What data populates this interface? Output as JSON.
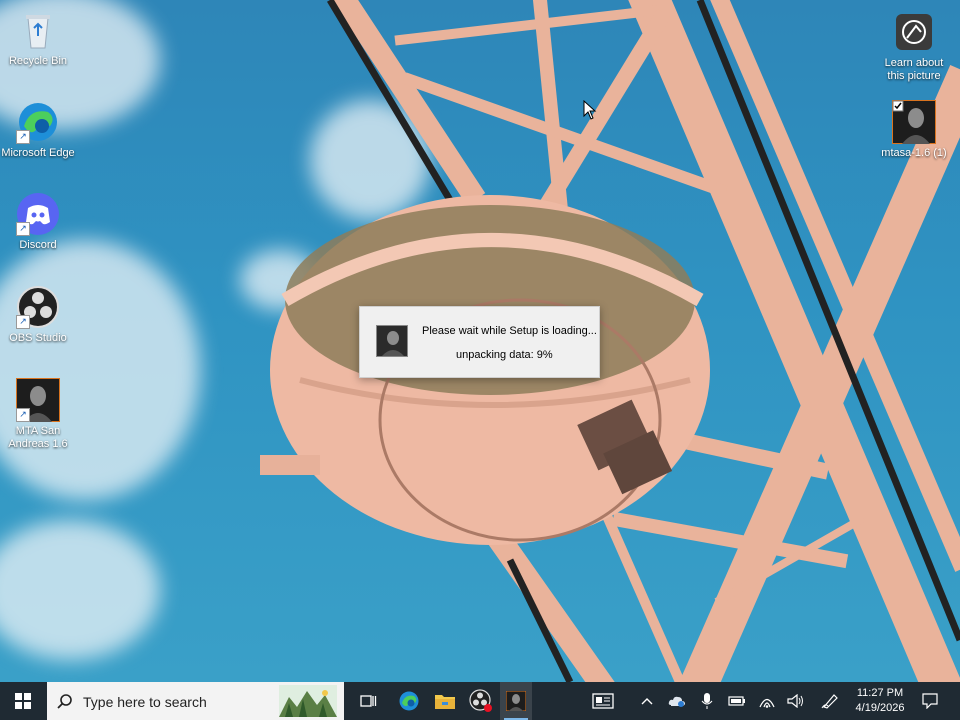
{
  "desktop": {
    "icons": [
      {
        "label": "Recycle Bin"
      },
      {
        "label": "Microsoft Edge"
      },
      {
        "label": "Discord"
      },
      {
        "label": "OBS Studio"
      },
      {
        "label": "MTA San Andreas 1.6"
      },
      {
        "label": "Learn about this picture"
      },
      {
        "label": "mtasa-1.6 (1)"
      }
    ]
  },
  "dialog": {
    "message": "Please wait while Setup is loading...",
    "status": "unpacking data: 9%",
    "progress_percent": 9
  },
  "taskbar": {
    "search_placeholder": "Type here to search",
    "time": "11:27 PM",
    "date": "4/19/2026"
  }
}
